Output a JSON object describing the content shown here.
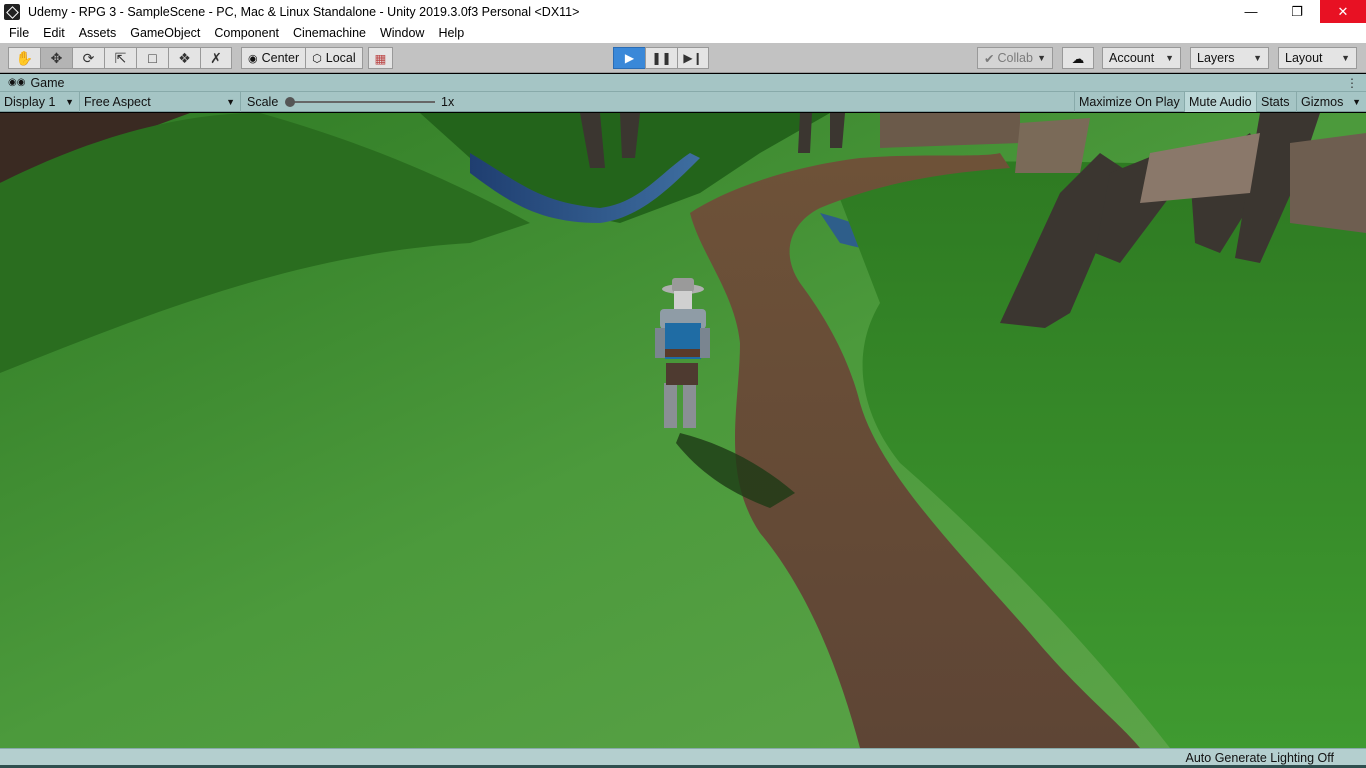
{
  "window": {
    "title": "Udemy - RPG 3 - SampleScene - PC, Mac & Linux Standalone - Unity 2019.3.0f3 Personal <DX11>",
    "controls": [
      "minimize-icon",
      "restore-icon",
      "close-icon"
    ]
  },
  "menu": {
    "items": [
      "File",
      "Edit",
      "Assets",
      "GameObject",
      "Component",
      "Cinemachine",
      "Window",
      "Help"
    ]
  },
  "toolbar": {
    "tools": [
      "hand-icon",
      "move-icon",
      "rotate-icon",
      "scale-icon",
      "rect-icon",
      "transform-icon",
      "custom-tool-icon"
    ],
    "pivot_label": "Center",
    "space_label": "Local",
    "snap_icon": "grid-snap-icon",
    "play_controls": [
      "play-icon",
      "pause-icon",
      "step-icon"
    ],
    "collab_label": "Collab",
    "cloud_icon": "cloud-icon",
    "account_label": "Account",
    "layers_label": "Layers",
    "layout_label": "Layout",
    "play_active_color": "#3a88d8"
  },
  "tabs": {
    "game_label": "Game",
    "game_icon": "gamepad-icon"
  },
  "gamebar": {
    "display": "Display 1",
    "aspect": "Free Aspect",
    "scale_label": "Scale",
    "scale_value": "1x",
    "maximize_on_play": "Maximize On Play",
    "mute_audio": "Mute Audio",
    "stats": "Stats",
    "gizmos": "Gizmos"
  },
  "status": {
    "text": "Auto Generate Lighting Off"
  }
}
